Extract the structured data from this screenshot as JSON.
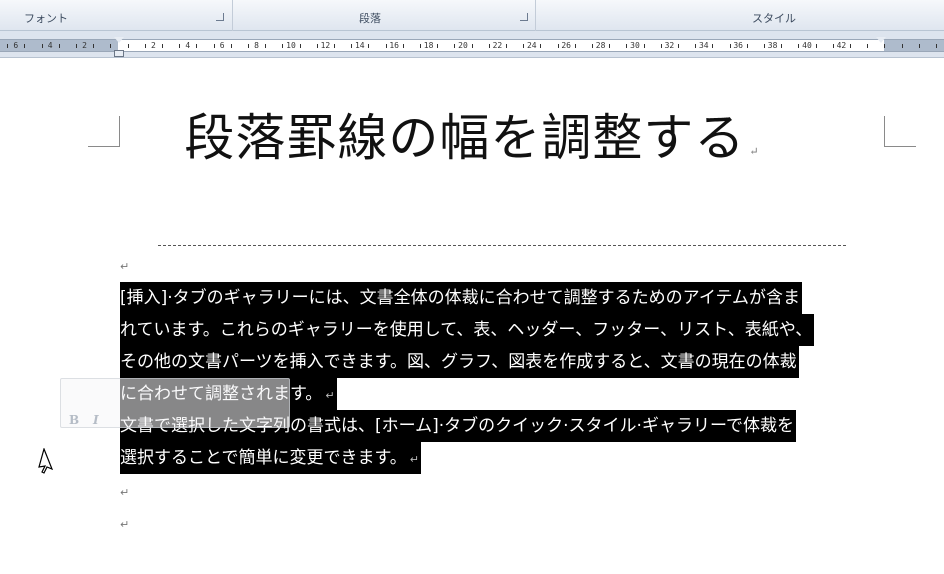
{
  "ribbon": {
    "groups": [
      {
        "label": "フォント"
      },
      {
        "label": "段落"
      },
      {
        "label": "スタイル"
      }
    ]
  },
  "ruler": {
    "labels": [
      "6",
      "4",
      "2",
      "2",
      "4",
      "6",
      "8",
      "10",
      "12",
      "14",
      "16",
      "18",
      "20",
      "22",
      "24",
      "26",
      "28",
      "30",
      "32",
      "34",
      "36",
      "38",
      "40",
      "42"
    ]
  },
  "document": {
    "title": "段落罫線の幅を調整する",
    "paragraph_mark": "↵",
    "paragraph1_lines": [
      "[挿入]·タブのギャラリーには、文書全体の体裁に合わせて調整するためのアイテムが含ま",
      "れています。これらのギャラリーを使用して、表、ヘッダー、フッター、リスト、表紙や、",
      "その他の文書パーツを挿入できます。図、グラフ、図表を作成すると、文書の現在の体裁",
      "に合わせて調整されます。"
    ],
    "paragraph2_lines": [
      "文書で選択した文字列の書式は、[ホーム]·タブのクイック·スタイル·ギャラリーで体裁を",
      "選択することで簡単に変更できます。"
    ]
  },
  "mini_toolbar": {
    "bold": "B",
    "italic": "I"
  },
  "colors": {
    "selection": "#000000",
    "selection_text": "#ffffff",
    "ribbon_bg": "#dfe6ef"
  },
  "icons": {
    "cursor": "arrow-pointer-icon",
    "launcher": "dialog-launcher-icon"
  }
}
